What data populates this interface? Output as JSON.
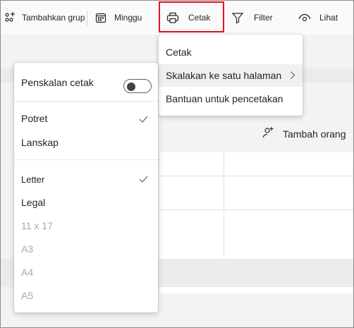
{
  "toolbar": {
    "add_group_label": "Tambahkan grup",
    "week_label": "Minggu",
    "print_label": "Cetak",
    "filter_label": "Filter",
    "view_label": "Lihat"
  },
  "print_menu": {
    "items": [
      {
        "label": "Cetak"
      },
      {
        "label": "Skalakan ke satu halaman"
      },
      {
        "label": "Bantuan untuk pencetakan"
      }
    ]
  },
  "scale_menu": {
    "scale_print_label": "Penskalan cetak",
    "scale_print_enabled": false,
    "orientation": [
      {
        "label": "Potret",
        "selected": true
      },
      {
        "label": "Lanskap",
        "selected": false
      }
    ],
    "paper_sizes": [
      {
        "label": "Letter",
        "selected": true,
        "enabled": true
      },
      {
        "label": "Legal",
        "selected": false,
        "enabled": true
      },
      {
        "label": "11 x 17",
        "selected": false,
        "enabled": false
      },
      {
        "label": "A3",
        "selected": false,
        "enabled": false
      },
      {
        "label": "A4",
        "selected": false,
        "enabled": false
      },
      {
        "label": "A5",
        "selected": false,
        "enabled": false
      }
    ]
  },
  "main": {
    "add_person_label": "Tambah orang"
  },
  "colors": {
    "highlight_border": "#e81123"
  }
}
